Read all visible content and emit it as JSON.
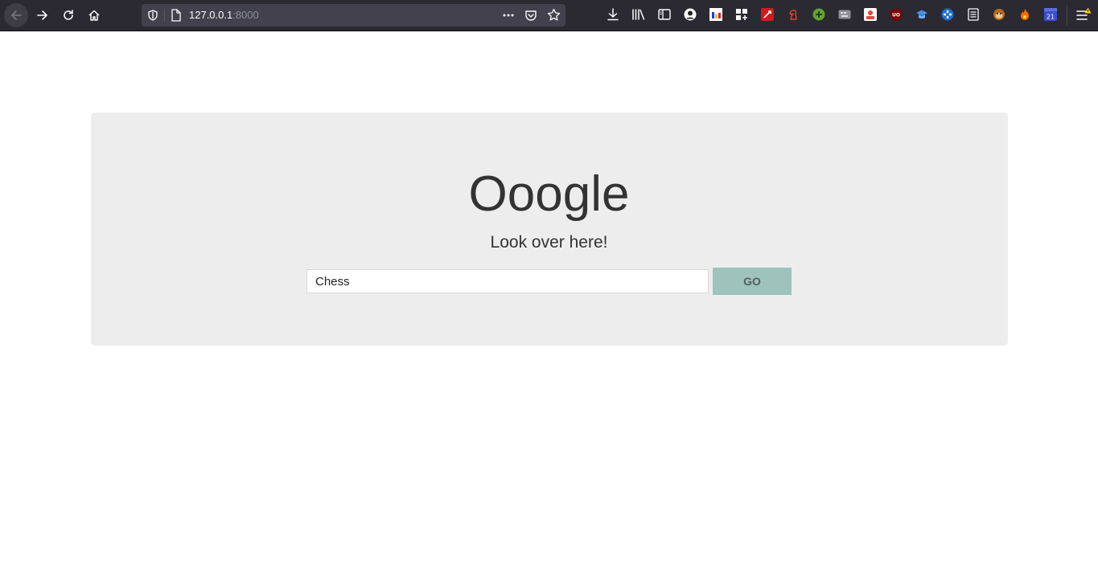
{
  "browser": {
    "url_host": "127.0.0.1",
    "url_port": ":8000",
    "nav_icons": [
      "back-arrow-icon",
      "forward-arrow-icon",
      "reload-icon",
      "home-icon"
    ],
    "url_icons": [
      "shield-icon",
      "page-icon",
      "more-options-icon",
      "pocket-icon",
      "bookmark-star-icon"
    ],
    "extensions": [
      {
        "name": "download-icon"
      },
      {
        "name": "library-icon"
      },
      {
        "name": "sidebar-icon"
      },
      {
        "name": "avatar-extension-icon"
      },
      {
        "name": "flag-extension-icon"
      },
      {
        "name": "grid-extension-icon"
      },
      {
        "name": "red-extension-icon"
      },
      {
        "name": "chess-knight-extension-icon"
      },
      {
        "name": "green-plus-extension-icon"
      },
      {
        "name": "keyboard-extension-icon"
      },
      {
        "name": "robot-extension-icon"
      },
      {
        "name": "ublock-extension-icon",
        "label": "UO"
      },
      {
        "name": "graduation-cap-extension-icon"
      },
      {
        "name": "blue-cross-extension-icon"
      },
      {
        "name": "notes-extension-icon"
      },
      {
        "name": "monkey-extension-icon"
      },
      {
        "name": "fire-extension-icon"
      },
      {
        "name": "calendar-extension-icon",
        "label": "21"
      },
      {
        "name": "hamburger-menu-icon"
      }
    ],
    "colors": {
      "toolbar_bg": "#2b2a33",
      "urlbar_bg": "#42414d"
    }
  },
  "page": {
    "title": "Ooogle",
    "tagline": "Look over here!",
    "search": {
      "value": "Chess"
    },
    "go_button_label": "GO",
    "colors": {
      "card_bg": "#ededed",
      "button_bg": "#9dc3ba",
      "text": "#333333"
    }
  }
}
